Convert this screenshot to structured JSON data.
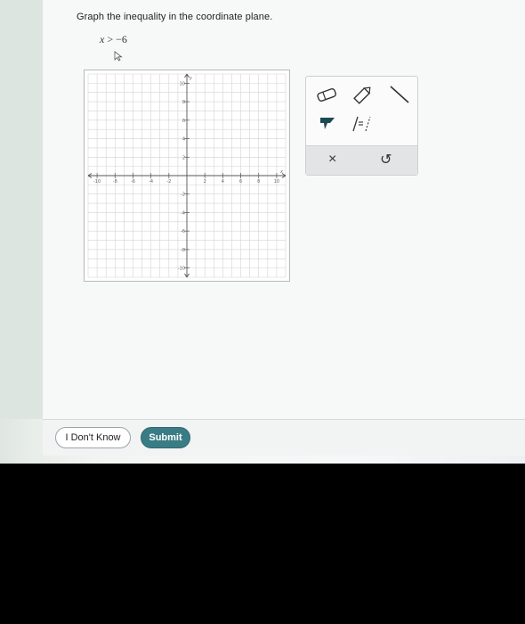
{
  "question": {
    "prompt": "Graph the inequality in the coordinate plane.",
    "inequality_var": "x",
    "inequality_op": ">",
    "inequality_value": "−6"
  },
  "graph": {
    "x_label": "x",
    "y_label": "y",
    "x_range": [
      -11,
      11
    ],
    "y_range": [
      -11,
      11
    ],
    "x_ticks": [
      "-10",
      "-8",
      "-6",
      "-4",
      "-2",
      "2",
      "4",
      "6",
      "8",
      "10"
    ],
    "y_ticks": [
      "10",
      "8",
      "6",
      "4",
      "2",
      "-2",
      "-4",
      "-6",
      "-8",
      "-10"
    ]
  },
  "toolbox": {
    "tools": [
      "eraser-icon",
      "pencil-icon",
      "line-icon",
      "fill-icon",
      "inequality-icon"
    ],
    "clear_symbol": "×",
    "undo_symbol": "↺"
  },
  "footer": {
    "dont_know_label": "I Don't Know",
    "submit_label": "Submit"
  },
  "colors": {
    "submit": "#3a7c86",
    "fill_tool": "#1c4a52"
  }
}
